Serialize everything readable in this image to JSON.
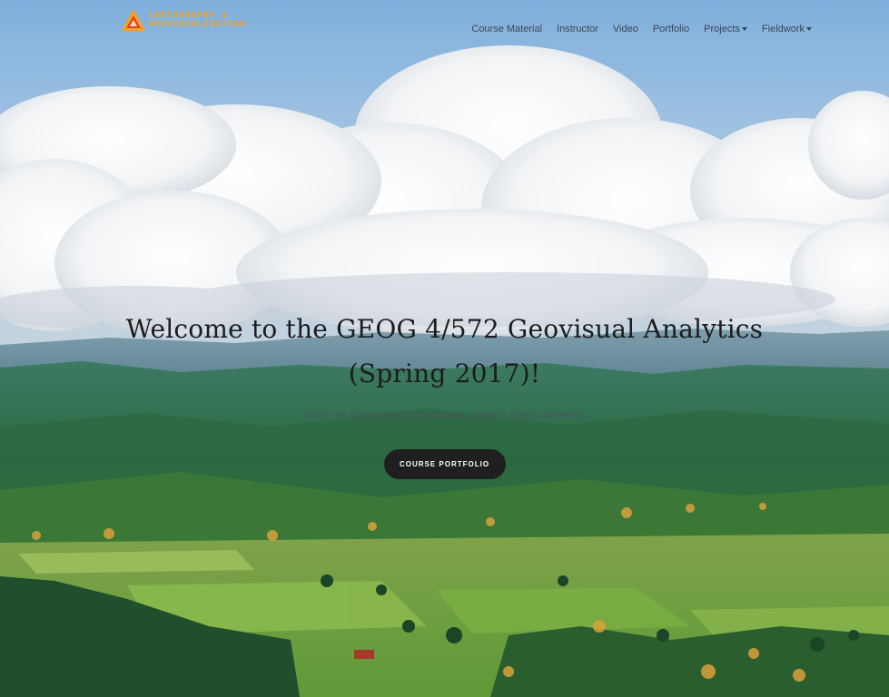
{
  "brand": {
    "line1": "CARTOGRAPHY &",
    "line2": "GEOVISUALIZATION",
    "colors": {
      "orange": "#f6a31c",
      "red": "#e0412b"
    }
  },
  "nav": {
    "items": [
      {
        "label": "Course Material"
      },
      {
        "label": "Instructor"
      },
      {
        "label": "Video"
      },
      {
        "label": "Portfolio"
      },
      {
        "label": "Projects",
        "dropdown": true
      },
      {
        "label": "Fieldwork",
        "dropdown": true
      }
    ]
  },
  "hero": {
    "title": "Welcome to the GEOG 4/572 Geovisual Analytics (Spring 2017)!",
    "subtitle": "From the Geography Department, Oregon State University",
    "button_label": "COURSE PORTFOLIO",
    "background": "sky-with-clouds-and-valley-photo"
  }
}
